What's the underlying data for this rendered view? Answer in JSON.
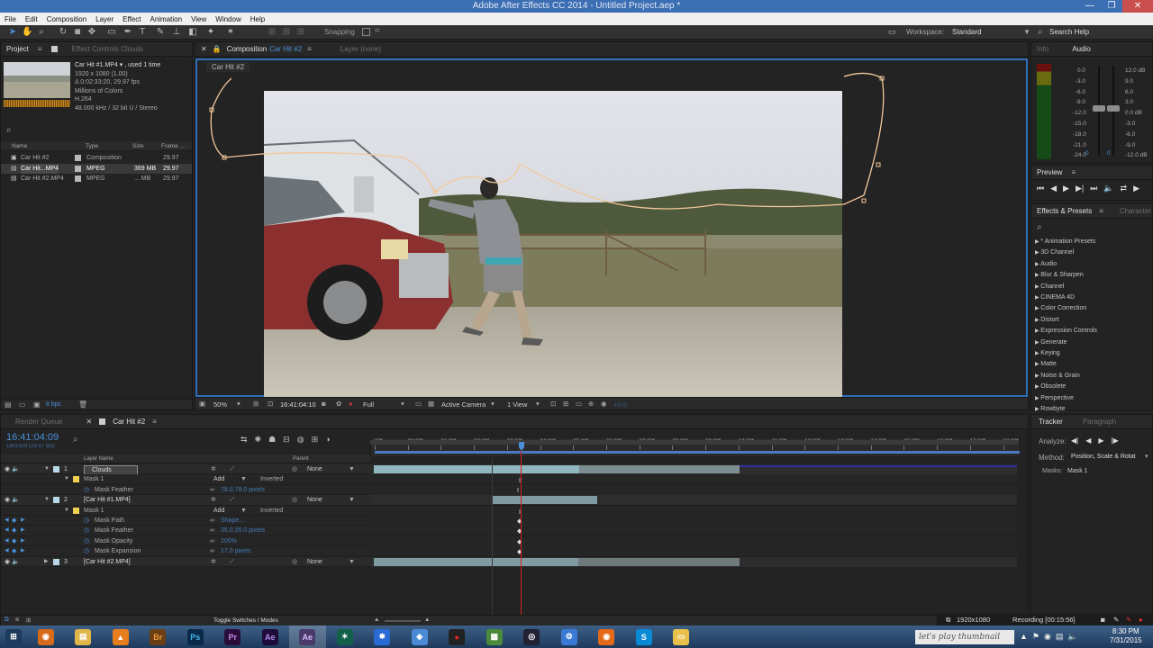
{
  "window": {
    "title": "Adobe After Effects CC 2014 - Untitled Project.aep *",
    "buttons": [
      "—",
      "❐",
      "✕"
    ]
  },
  "menu": [
    "File",
    "Edit",
    "Composition",
    "Layer",
    "Effect",
    "Animation",
    "View",
    "Window",
    "Help"
  ],
  "toolbar": {
    "snapping": "Snapping",
    "workspace_label": "Workspace:",
    "workspace_value": "Standard",
    "search_help": "Search Help"
  },
  "project_panel": {
    "tabs": [
      "Project",
      "Effect Controls Clouds"
    ],
    "selected_name": "Car Hit #1.MP4 ▾ , used 1 time",
    "info_lines": [
      "1920 x 1080 (1.00)",
      "Δ 0:02:33:20, 29.97 fps",
      "Millions of Colors",
      "H.264",
      "48.000 kHz / 32 bit U / Stereo"
    ],
    "columns": [
      "Name",
      "Type",
      "Size",
      "Frame ..."
    ],
    "items": [
      {
        "name": "Car Hit #2",
        "type": "Composition",
        "size": "",
        "frame": "29.97",
        "color": "#b8b8b8"
      },
      {
        "name": "Car Hit...MP4",
        "type": "MPEG",
        "size": "369 MB",
        "frame": "29.97",
        "color": "#b8b8b8"
      },
      {
        "name": "Car Hit #2.MP4",
        "type": "MPEG",
        "size": "... MB",
        "frame": "29.97",
        "color": "#b8b8b8"
      }
    ],
    "footer_bpc": "8 bpc"
  },
  "composition_panel": {
    "tab_label": "Composition",
    "tab_comp": "Car Hit #2",
    "layer_tab": "Layer (none)",
    "breadcrumb": "Car Hit #2",
    "footer": {
      "zoom": "50%",
      "timecode": "16:41:04:10",
      "resolution": "Full",
      "camera": "Active Camera",
      "views": "1 View",
      "exposure": "+0.0"
    }
  },
  "info_audio": {
    "tabs": [
      "Info",
      "Audio"
    ],
    "db_left": [
      "0.0",
      "-3.0",
      "-6.0",
      "-9.0",
      "-12.0",
      "-15.0",
      "-18.0",
      "-21.0",
      "-24.0"
    ],
    "db_right": [
      "12.0 dB",
      "9.0",
      "6.0",
      "3.0",
      "0.0 dB",
      "-3.0",
      "-6.0",
      "-9.0",
      "-12.0 dB"
    ],
    "knob_left": "0",
    "knob_right": "0"
  },
  "preview": {
    "title": "Preview"
  },
  "effects_presets": {
    "tabs": [
      "Effects & Presets",
      "Character"
    ],
    "items": [
      "* Animation Presets",
      "3D Channel",
      "Audio",
      "Blur & Sharpen",
      "Channel",
      "CINEMA 4D",
      "Color Correction",
      "Distort",
      "Expression Controls",
      "Generate",
      "Keying",
      "Matte",
      "Noise & Grain",
      "Obsolete",
      "Perspective",
      "Rowbyte"
    ]
  },
  "timeline": {
    "tabs": [
      "Render Queue",
      "Car Hit #2"
    ],
    "timecode": "16:41:04:09",
    "frame_info": "1801929 (29.97 fps)",
    "header": {
      "layer_name": "Layer Name",
      "parent": "Parent"
    },
    "ruler_ticks": [
      "00f",
      "00:28f",
      "01:28f",
      "02:28f",
      "03:28f",
      "04:28f",
      "05:28f",
      "06:28f",
      "07:28f",
      "08:28f",
      "09:28f",
      "10:28f",
      "11:28f",
      "12:28f",
      "13:28f",
      "14:28f",
      "15:28f",
      "16:28f",
      "17:28f",
      "18:28f"
    ],
    "layers": [
      {
        "num": "1",
        "name": "Clouds",
        "parent": "None",
        "bar_color": "#8fb7bf"
      },
      {
        "num": "2",
        "name": "[Car Hit #1.MP4]",
        "parent": "None",
        "bar_color": "#7f9aa0"
      },
      {
        "num": "3",
        "name": "[Car Hit #2.MP4]",
        "parent": "None",
        "bar_color": "#7f9aa0"
      }
    ],
    "mask1_props": {
      "mask": "Mask 1",
      "mode": "Add",
      "inverted": "Inverted",
      "feather_label": "Mask Feather",
      "feather_value": "78.0,78.0 pixels"
    },
    "mask2_props": {
      "mask": "Mask 1",
      "mode": "Add",
      "inverted": "Inverted",
      "path_label": "Mask Path",
      "path_value": "Shape...",
      "feather_label": "Mask Feather",
      "feather_value": "35.0,35.0 pixels",
      "opacity_label": "Mask Opacity",
      "opacity_value": "100%",
      "expansion_label": "Mask Expansion",
      "expansion_value": "17.0 pixels"
    },
    "footer": "Toggle Switches / Modes"
  },
  "tracker": {
    "tabs": [
      "Tracker",
      "Paragraph"
    ],
    "analyze_label": "Analyze:",
    "method_label": "Method:",
    "method_value": "Position, Scale & Rotat",
    "masks_label": "Masks:",
    "masks_value": "Mask 1"
  },
  "statusbar": {
    "resolution": "1920x1080",
    "recording": "Recording [00:15:56]"
  },
  "taskbar": {
    "apps": [
      "windows-start",
      "firefox",
      "file-explorer",
      "vlc",
      "bridge",
      "photoshop",
      "premiere",
      "after-effects",
      "after-effects-active",
      "camtasia",
      "settings",
      "3d-box",
      "record",
      "minecraft",
      "steam",
      "gear-app",
      "origin",
      "skype",
      "folder"
    ],
    "thumbnail_text": "let's play thumbnail",
    "clock_time": "8:30 PM",
    "clock_date": "7/31/2015"
  }
}
